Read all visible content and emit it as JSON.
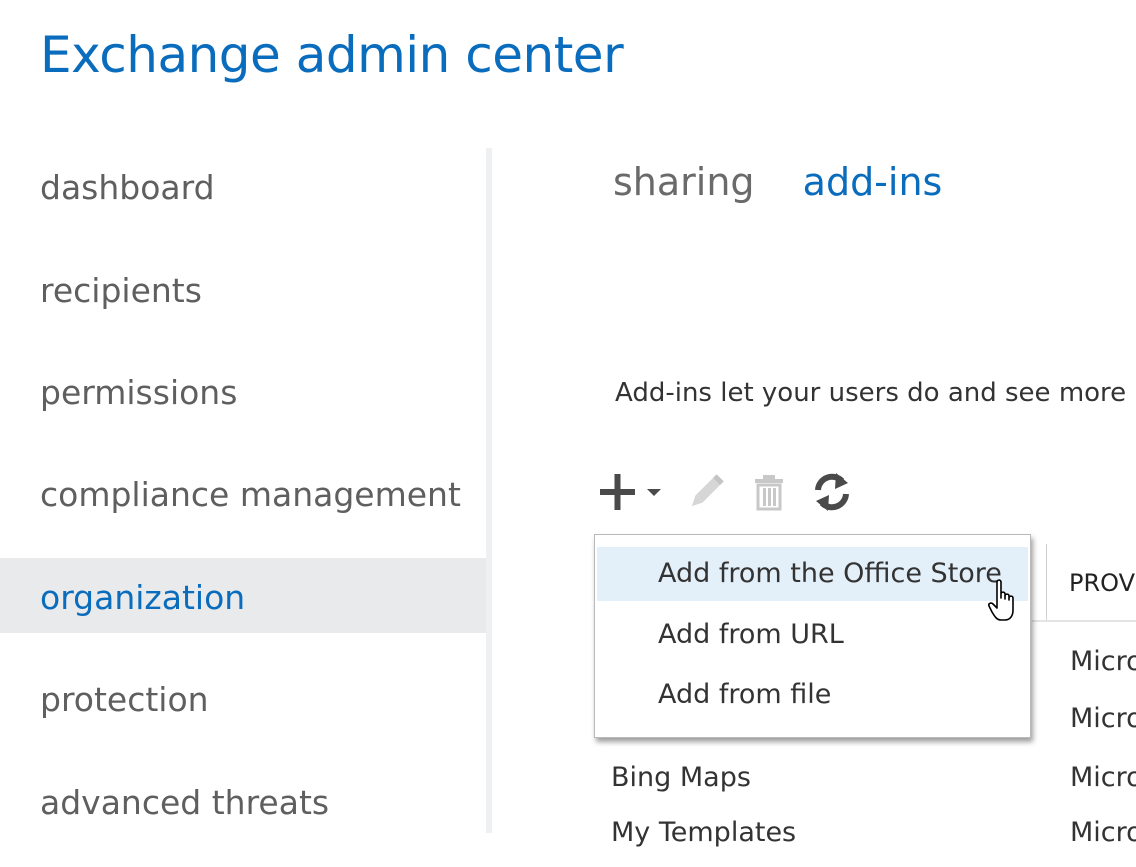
{
  "app": {
    "title": "Exchange admin center"
  },
  "sidebar": {
    "items": [
      {
        "label": "dashboard"
      },
      {
        "label": "recipients"
      },
      {
        "label": "permissions"
      },
      {
        "label": "compliance management"
      },
      {
        "label": "organization",
        "selected": true
      },
      {
        "label": "protection"
      },
      {
        "label": "advanced threats"
      }
    ]
  },
  "tabs": [
    {
      "label": "sharing"
    },
    {
      "label": "add-ins",
      "active": true
    }
  ],
  "main": {
    "description": "Add-ins let your users do and see more"
  },
  "toolbar": {
    "icons": [
      "add-icon",
      "dropdown-arrow-icon",
      "edit-icon",
      "delete-icon",
      "refresh-icon"
    ]
  },
  "dropdown": {
    "items": [
      {
        "label": "Add from the Office Store",
        "hover": true
      },
      {
        "label": "Add from URL"
      },
      {
        "label": "Add from file"
      }
    ]
  },
  "table": {
    "provider_header": "PROV",
    "rows": [
      {
        "name": "",
        "provider": "Micro"
      },
      {
        "name": "",
        "provider": "Micro"
      },
      {
        "name": "Bing Maps",
        "provider": "Micro"
      },
      {
        "name": "My Templates",
        "provider": "Micro"
      }
    ]
  },
  "colors": {
    "accent": "#0a6cbd",
    "nav_text": "#5f5f5f",
    "selected_bg": "#e9eaec",
    "hover_bg": "#e3eff9"
  }
}
